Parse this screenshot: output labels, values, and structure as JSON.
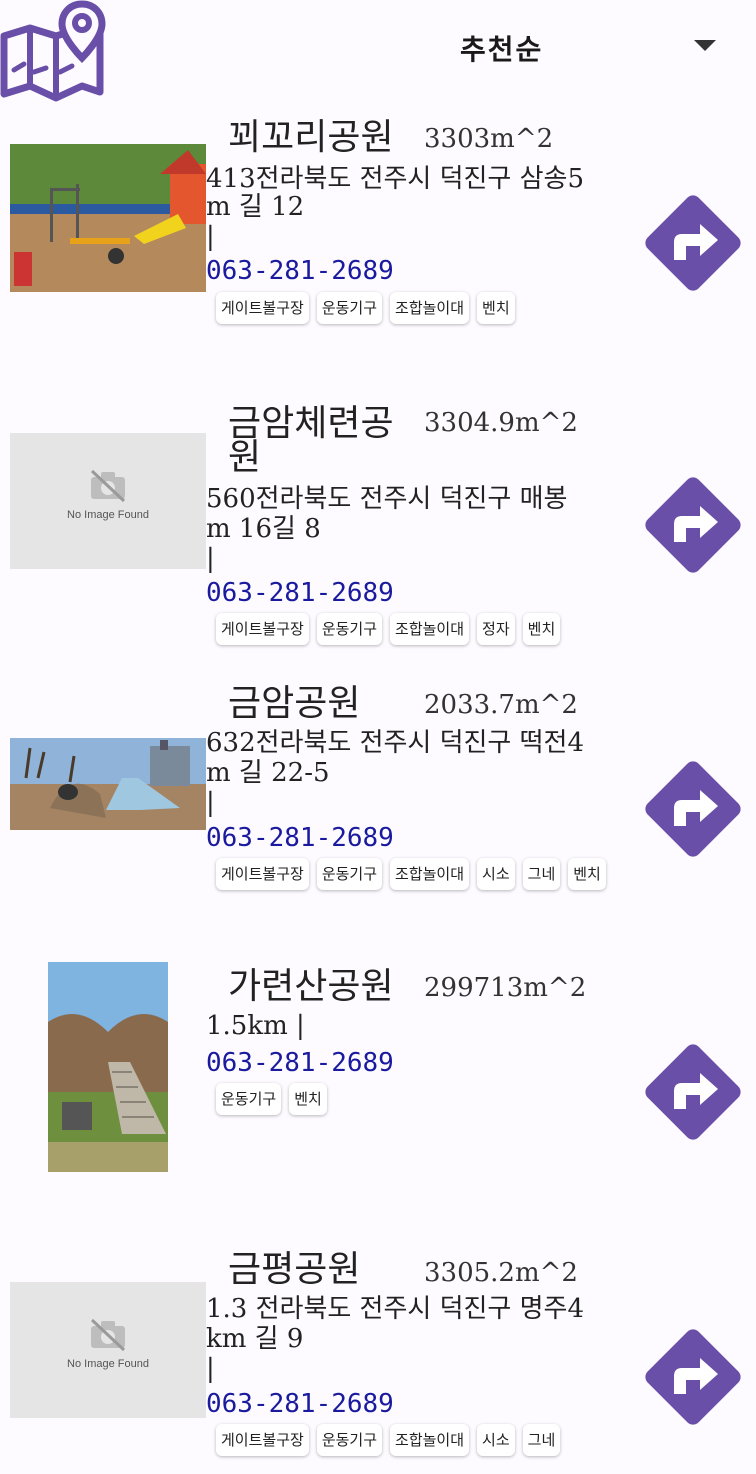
{
  "header": {
    "map_icon": "map-pin-icon",
    "sort_label": "추천순",
    "sort_arrow_icon": "dropdown-arrow-icon"
  },
  "no_image_text": "No Image Found",
  "nav_icon": "turn-right-direction-icon",
  "parks": [
    {
      "name": "꾀꼬리공원",
      "area": "3303m^2",
      "distance": "413m",
      "address_line1": "413전라북도 전주시 덕진구 삼송5",
      "address_line2": "m   길 12",
      "separator": "|",
      "phone": "063-281-2689",
      "facilities": [
        "게이트볼구장",
        "운동기구",
        "조합놀이대",
        "벤치"
      ]
    },
    {
      "name_line1": "금암체련공",
      "name_line2": "원",
      "area": "3304.9m^2",
      "address_line1": "560전라북도 전주시 덕진구 매봉",
      "address_line2": "m   16길 8",
      "separator": "|",
      "phone": "063-281-2689",
      "facilities": [
        "게이트볼구장",
        "운동기구",
        "조합놀이대",
        "정자",
        "벤치"
      ]
    },
    {
      "name": "금암공원",
      "area": "2033.7m^2",
      "address_line1": "632전라북도 전주시 덕진구 떡전4",
      "address_line2": "m   길 22-5",
      "separator": "|",
      "phone": "063-281-2689",
      "facilities": [
        "게이트볼구장",
        "운동기구",
        "조합놀이대",
        "시소",
        "그네",
        "벤치"
      ]
    },
    {
      "name": "가련산공원",
      "area": "299713m^2",
      "address_line1": "1.5km |",
      "phone": "063-281-2689",
      "facilities": [
        "운동기구",
        "벤치"
      ]
    },
    {
      "name": "금평공원",
      "area": "3305.2m^2",
      "address_line1": "1.3  전라북도 전주시 덕진구 명주4",
      "address_line2": "km  길 9",
      "separator": "|",
      "phone": "063-281-2689",
      "facilities": [
        "게이트볼구장",
        "운동기구",
        "조합놀이대",
        "시소",
        "그네"
      ]
    }
  ]
}
